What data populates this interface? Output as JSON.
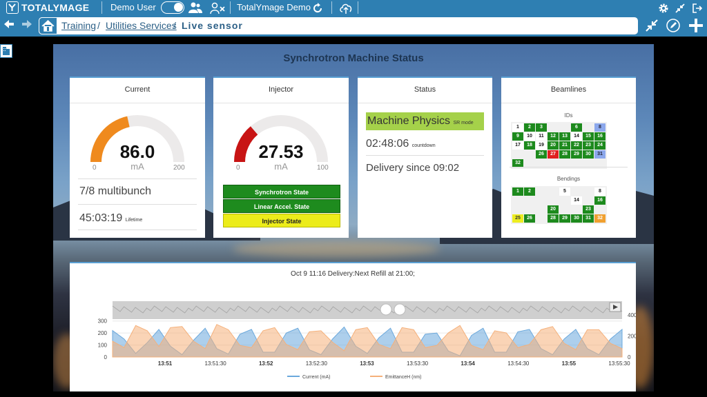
{
  "app": {
    "logo_text": "TOTALYMAGE",
    "user": "Demo User",
    "project": "TotalYmage Demo"
  },
  "breadcrumb": {
    "items": [
      "Training",
      "Utilities Services",
      "Live sensor"
    ]
  },
  "dashboard": {
    "title": "Synchrotron Machine Status",
    "current": {
      "title": "Current",
      "value": "86.0",
      "value_num": 86.0,
      "unit": "mA",
      "min": "0",
      "max": "200",
      "max_num": 200,
      "mode": "7/8 multibunch",
      "lifetime": "45:03:19",
      "lifetime_label": "Lifetime",
      "color": "#ef8a1e"
    },
    "injector": {
      "title": "Injector",
      "value": "27.53",
      "value_num": 27.53,
      "unit": "mA",
      "min": "0",
      "max": "100",
      "max_num": 100,
      "color": "#c81414",
      "states": [
        "Synchrotron State",
        "Linear Accel. State",
        "Injector State"
      ]
    },
    "status": {
      "title": "Status",
      "machine": "Machine Physics",
      "machine_sub": "SR mode",
      "countdown": "02:48:06",
      "countdown_label": "countdown",
      "delivery": "Delivery since 09:02"
    },
    "beamlines": {
      "title": "Beamlines",
      "ids_label": "IDs",
      "ids": [
        [
          "",
          "w",
          "1"
        ],
        [
          "",
          "g",
          "2"
        ],
        [
          "",
          "g",
          "3"
        ],
        [
          "",
          "e",
          ""
        ],
        [
          "",
          "e",
          ""
        ],
        [
          "",
          "g",
          "6"
        ],
        [
          "",
          "e",
          ""
        ],
        [
          "",
          "b",
          "8"
        ],
        [
          "",
          "g",
          "9"
        ],
        [
          "",
          "w",
          "10"
        ],
        [
          "",
          "w",
          "11"
        ],
        [
          "",
          "g",
          "12"
        ],
        [
          "",
          "g",
          "13"
        ],
        [
          "",
          "w",
          "14"
        ],
        [
          "",
          "g",
          "15"
        ],
        [
          "",
          "g",
          "16"
        ],
        [
          "",
          "w",
          "17"
        ],
        [
          "",
          "g",
          "18"
        ],
        [
          "",
          "w",
          "19"
        ],
        [
          "",
          "g",
          "20"
        ],
        [
          "",
          "g",
          "21"
        ],
        [
          "",
          "g",
          "22"
        ],
        [
          "",
          "g",
          "23"
        ],
        [
          "",
          "g",
          "24"
        ],
        [
          "",
          "e",
          ""
        ],
        [
          "",
          "e",
          ""
        ],
        [
          "",
          "g",
          "26"
        ],
        [
          "",
          "r",
          "27"
        ],
        [
          "",
          "g",
          "28"
        ],
        [
          "",
          "g",
          "29"
        ],
        [
          "",
          "g",
          "30"
        ],
        [
          "",
          "b",
          "31"
        ],
        [
          "",
          "g",
          "32"
        ]
      ],
      "bendings_label": "Bendings",
      "bendings": [
        [
          "",
          "g",
          "1"
        ],
        [
          "",
          "g",
          "2"
        ],
        [
          "",
          "e",
          ""
        ],
        [
          "",
          "e",
          ""
        ],
        [
          "",
          "w",
          "5"
        ],
        [
          "",
          "e",
          ""
        ],
        [
          "",
          "e",
          ""
        ],
        [
          "",
          "w",
          "8"
        ],
        [
          "",
          "e",
          ""
        ],
        [
          "",
          "e",
          ""
        ],
        [
          "",
          "e",
          ""
        ],
        [
          "",
          "e",
          ""
        ],
        [
          "",
          "e",
          ""
        ],
        [
          "",
          "w",
          "14"
        ],
        [
          "",
          "e",
          ""
        ],
        [
          "",
          "g",
          "16"
        ],
        [
          "",
          "e",
          ""
        ],
        [
          "",
          "e",
          ""
        ],
        [
          "",
          "e",
          ""
        ],
        [
          "",
          "g",
          "20"
        ],
        [
          "",
          "e",
          ""
        ],
        [
          "",
          "e",
          ""
        ],
        [
          "",
          "g",
          "23"
        ],
        [
          "",
          "e",
          ""
        ],
        [
          "",
          "y",
          "25"
        ],
        [
          "",
          "g",
          "26"
        ],
        [
          "",
          "e",
          ""
        ],
        [
          "",
          "g",
          "28"
        ],
        [
          "",
          "g",
          "29"
        ],
        [
          "",
          "g",
          "30"
        ],
        [
          "",
          "g",
          "31"
        ],
        [
          "",
          "o",
          "32"
        ]
      ]
    }
  },
  "chart_data": {
    "type": "area",
    "title": "Oct 9 11:16 Delivery:Next Refill at 21:00;",
    "x_ticks": [
      "13:51",
      "13:51:30",
      "13:52",
      "13:52:30",
      "13:53",
      "13:53:30",
      "13:54",
      "13:54:30",
      "13:55",
      "13:55:30"
    ],
    "x_ticks_bold": [
      true,
      false,
      true,
      false,
      true,
      false,
      true,
      false,
      true,
      false
    ],
    "y_left_ticks": [
      "0",
      "100",
      "200",
      "300"
    ],
    "y_left_lim": [
      0,
      350
    ],
    "y_right_ticks": [
      "0",
      "200",
      "400"
    ],
    "y_right_lim": [
      0,
      400
    ],
    "series": [
      {
        "name": "Current (mA)",
        "axis": "left",
        "color": "#6aa8dc",
        "values": [
          220,
          150,
          30,
          120,
          230,
          90,
          20,
          140,
          240,
          70,
          25,
          190,
          230,
          40,
          40,
          200,
          240,
          60,
          20,
          150,
          250,
          90,
          30,
          160,
          240,
          40,
          40,
          190,
          200,
          50,
          10,
          180,
          240,
          40,
          40,
          210,
          230,
          70,
          20,
          150,
          230,
          70,
          20,
          150,
          230
        ]
      },
      {
        "name": "EmittanceH (nm)",
        "axis": "right",
        "color": "#f5b07a",
        "values": [
          150,
          90,
          300,
          250,
          100,
          280,
          290,
          150,
          80,
          310,
          260,
          110,
          90,
          250,
          280,
          120,
          70,
          240,
          250,
          140,
          60,
          260,
          280,
          120,
          80,
          280,
          260,
          90,
          110,
          230,
          300,
          110,
          70,
          250,
          230,
          90,
          120,
          260,
          290,
          130,
          70,
          260,
          260,
          130,
          80
        ]
      }
    ],
    "legend_position": "bottom"
  }
}
